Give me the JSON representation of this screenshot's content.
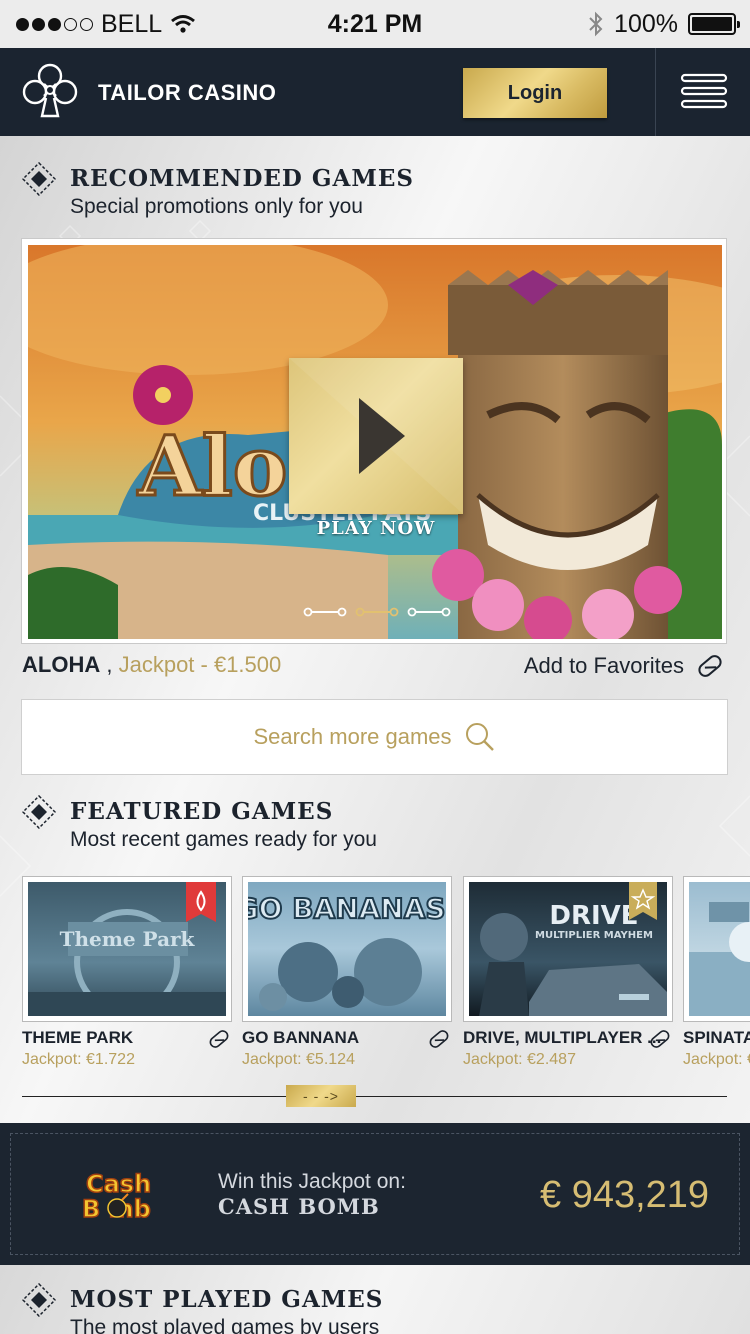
{
  "status_bar": {
    "carrier": "BELL",
    "time": "4:21 PM",
    "battery": "100%",
    "signal_bars_filled": 3,
    "signal_bars_total": 5
  },
  "header": {
    "brand": "TAILOR CASINO",
    "login_label": "Login",
    "icons": [
      "club-logo-icon",
      "hamburger-menu-icon"
    ]
  },
  "recommended": {
    "title": "RECOMMENDED GAMES",
    "subtitle": "Special promotions only for you",
    "play_label": "PLAY NOW",
    "carousel_total": 3,
    "carousel_active": 2,
    "game_name": "ALOHA",
    "separator": ",",
    "jackpot": "Jackpot - €1.500",
    "favorites_label": "Add to Favorites"
  },
  "search": {
    "label": "Search more games"
  },
  "featured": {
    "title": "FEATURED GAMES",
    "subtitle": "Most recent games ready for you",
    "games": [
      {
        "title": "THEME PARK",
        "jackpot": "Jackpot: €1.722"
      },
      {
        "title": "GO BANNANA",
        "jackpot": "Jackpot: €5.124"
      },
      {
        "title": "DRIVE, MULTIPLAYER ...",
        "jackpot": "Jackpot: €2.487"
      },
      {
        "title": "SPINATA G",
        "jackpot": "Jackpot: €"
      }
    ],
    "slider_label": "- - ->"
  },
  "jackpot_banner": {
    "prefix": "Win this Jackpot on:",
    "game": "CASH BOMB",
    "amount": "€ 943,219"
  },
  "most_played": {
    "title": "MOST PLAYED GAMES",
    "subtitle": "The most played games by users"
  },
  "colors": {
    "navy": "#1b2430",
    "gold": "#d6bd73",
    "gold_text": "#b8a05e",
    "light_bg": "#ebebeb"
  }
}
